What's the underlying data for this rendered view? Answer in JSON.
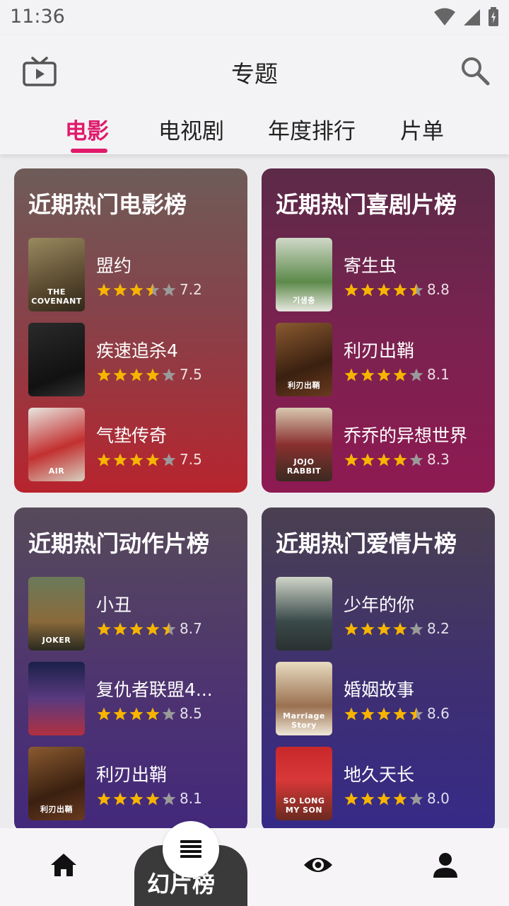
{
  "status": {
    "time": "11:36"
  },
  "header": {
    "title": "专题"
  },
  "tabs": [
    {
      "label": "电影"
    },
    {
      "label": "电视剧"
    },
    {
      "label": "年度排行"
    },
    {
      "label": "片单"
    }
  ],
  "cards": [
    {
      "title": "近期热门电影榜",
      "movies": [
        {
          "title": "盟约",
          "rating": "7.2",
          "stars": 3.5,
          "poster_text": "THE COVENANT"
        },
        {
          "title": "疾速追杀4",
          "rating": "7.5",
          "stars": 4,
          "poster_text": ""
        },
        {
          "title": "气垫传奇",
          "rating": "7.5",
          "stars": 4,
          "poster_text": "AIR"
        }
      ]
    },
    {
      "title": "近期热门喜剧片榜",
      "movies": [
        {
          "title": "寄生虫",
          "rating": "8.8",
          "stars": 4.5,
          "poster_text": "기생충"
        },
        {
          "title": "利刃出鞘",
          "rating": "8.1",
          "stars": 4,
          "poster_text": "利刃出鞘"
        },
        {
          "title": "乔乔的异想世界",
          "rating": "8.3",
          "stars": 4,
          "poster_text": "JOJO RABBIT"
        }
      ]
    },
    {
      "title": "近期热门动作片榜",
      "movies": [
        {
          "title": "小丑",
          "rating": "8.7",
          "stars": 4.5,
          "poster_text": "JOKER"
        },
        {
          "title": "复仇者联盟4...",
          "rating": "8.5",
          "stars": 4,
          "poster_text": ""
        },
        {
          "title": "利刃出鞘",
          "rating": "8.1",
          "stars": 4,
          "poster_text": "利刃出鞘"
        }
      ]
    },
    {
      "title": "近期热门爱情片榜",
      "movies": [
        {
          "title": "少年的你",
          "rating": "8.2",
          "stars": 4,
          "poster_text": ""
        },
        {
          "title": "婚姻故事",
          "rating": "8.6",
          "stars": 4.5,
          "poster_text": "Marriage Story"
        },
        {
          "title": "地久天长",
          "rating": "8.0",
          "stars": 4,
          "poster_text": "SO LONG MY SON"
        }
      ]
    }
  ],
  "bottom_nav": {
    "peek_label": "幻片榜",
    "items": [
      "home-icon",
      "menu-icon",
      "eye-icon",
      "person-icon"
    ]
  },
  "colors": {
    "accent": "#e0196b",
    "star": "#f7b500",
    "star_empty": "#9a9a9a"
  }
}
